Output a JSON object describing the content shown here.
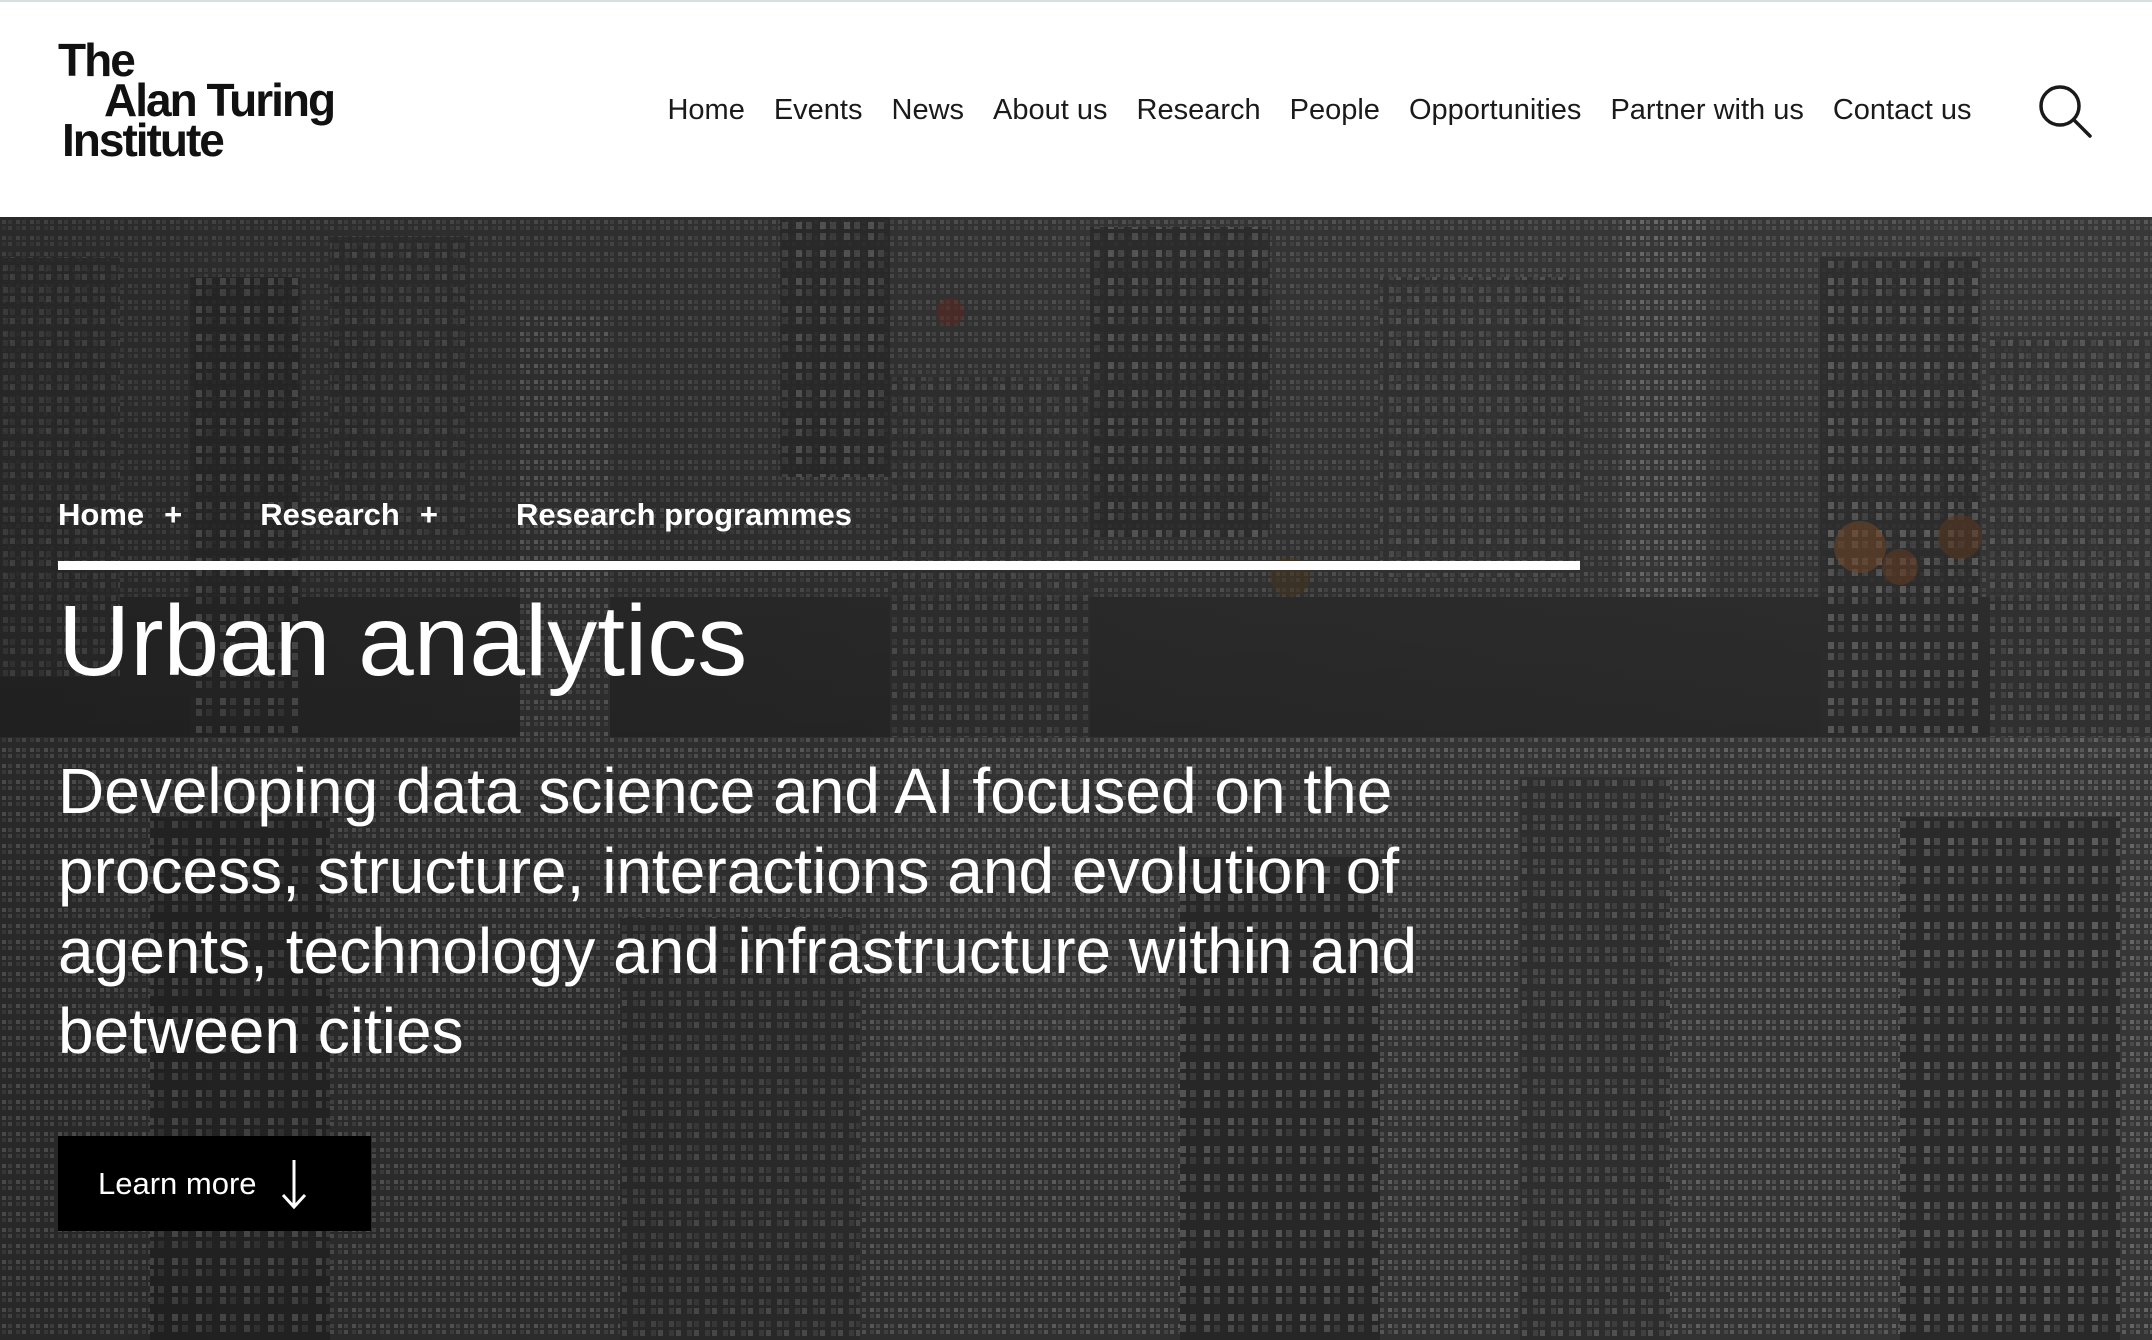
{
  "logo": {
    "line1": "The",
    "line2": "Alan Turing",
    "line3": "Institute"
  },
  "nav": {
    "items": [
      {
        "label": "Home"
      },
      {
        "label": "Events"
      },
      {
        "label": "News"
      },
      {
        "label": "About us"
      },
      {
        "label": "Research"
      },
      {
        "label": "People"
      },
      {
        "label": "Opportunities"
      },
      {
        "label": "Partner with us"
      },
      {
        "label": "Contact us"
      }
    ],
    "search_icon": "search-icon"
  },
  "breadcrumb": {
    "items": [
      {
        "label": "Home"
      },
      {
        "label": "Research"
      },
      {
        "label": "Research programmes"
      }
    ],
    "separator": "+"
  },
  "hero": {
    "title": "Urban analytics",
    "subtitle": "Developing data science and AI focused on the process, structure, interactions and evolution of agents, technology and infrastructure within and between cities",
    "cta_label": "Learn more",
    "cta_icon": "arrow-down-icon",
    "background": "city-skyline-photo"
  },
  "colors": {
    "header_bg": "#ffffff",
    "nav_text": "#1a1a1a",
    "hero_text": "#ffffff",
    "cta_bg": "#000000"
  }
}
